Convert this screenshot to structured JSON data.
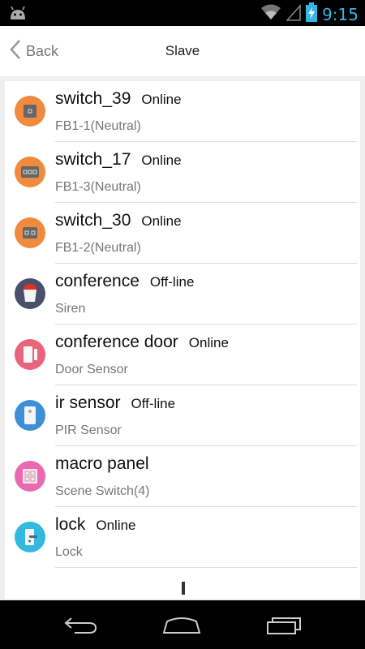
{
  "status_bar": {
    "time": "9:15",
    "icons": [
      "android-icon",
      "wifi-icon",
      "signal-icon",
      "battery-charging-icon"
    ],
    "accent_color": "#33b5e5"
  },
  "header": {
    "back_label": "Back",
    "title": "Slave"
  },
  "devices": [
    {
      "name": "switch_39",
      "status": "Online",
      "type": "FB1-1(Neutral)",
      "icon": "switch-one-gang-icon",
      "icon_color": "#f08a3c"
    },
    {
      "name": "switch_17",
      "status": "Online",
      "type": "FB1-3(Neutral)",
      "icon": "switch-three-gang-icon",
      "icon_color": "#f08a3c"
    },
    {
      "name": "switch_30",
      "status": "Online",
      "type": "FB1-2(Neutral)",
      "icon": "switch-two-gang-icon",
      "icon_color": "#f08a3c"
    },
    {
      "name": "conference",
      "status": "Off-line",
      "type": "Siren",
      "icon": "siren-icon",
      "icon_color": "#4a4f6a"
    },
    {
      "name": "conference door",
      "status": "Online",
      "type": "Door Sensor",
      "icon": "door-sensor-icon",
      "icon_color": "#e8647a"
    },
    {
      "name": "ir sensor",
      "status": "Off-line",
      "type": "PIR Sensor",
      "icon": "pir-sensor-icon",
      "icon_color": "#3f8fd6"
    },
    {
      "name": "macro panel",
      "status": "",
      "type": "Scene Switch(4)",
      "icon": "scene-switch-icon",
      "icon_color": "#e96ab0"
    },
    {
      "name": "lock",
      "status": "Online",
      "type": "Lock",
      "icon": "lock-icon",
      "icon_color": "#33b8e0"
    }
  ],
  "nav_bar": {
    "icons": [
      "back-nav-icon",
      "home-nav-icon",
      "recent-apps-icon"
    ]
  }
}
